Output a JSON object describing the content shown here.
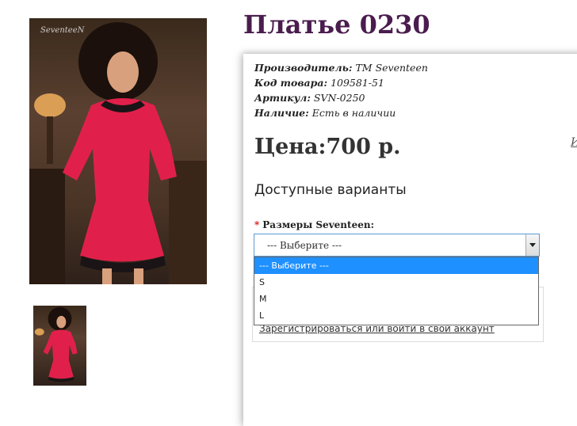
{
  "product": {
    "title": "Платье 0230",
    "meta": [
      {
        "label": "Производитель:",
        "value": "TM Seventeen"
      },
      {
        "label": "Код товара:",
        "value": "109581-51"
      },
      {
        "label": "Артикул:",
        "value": "SVN-0250"
      },
      {
        "label": "Наличие:",
        "value": "Есть в наличии"
      }
    ],
    "price": "Цена:700 р.",
    "edge_link": "И"
  },
  "photos": {
    "watermark": "SeventeeN",
    "colors": {
      "dress": "#e0204a",
      "lace": "#1a1416",
      "skin": "#d9a07d",
      "hair": "#1b100b",
      "lamp": "#e9a95a"
    }
  },
  "variants": {
    "title": "Доступные варианты",
    "required_mark": "*",
    "size_label": "Размеры Seventeen:",
    "selected": "--- Выберите ---",
    "options": [
      "--- Выберите ---",
      "S",
      "M",
      "L"
    ]
  },
  "cart": {
    "login_link": "Зарегистрироваться или войти в свой аккаунт"
  },
  "colors": {
    "title": "#4a1d4e",
    "select_border": "#5b9bd5",
    "option_highlight": "#1e90ff",
    "required": "#dd1111"
  }
}
